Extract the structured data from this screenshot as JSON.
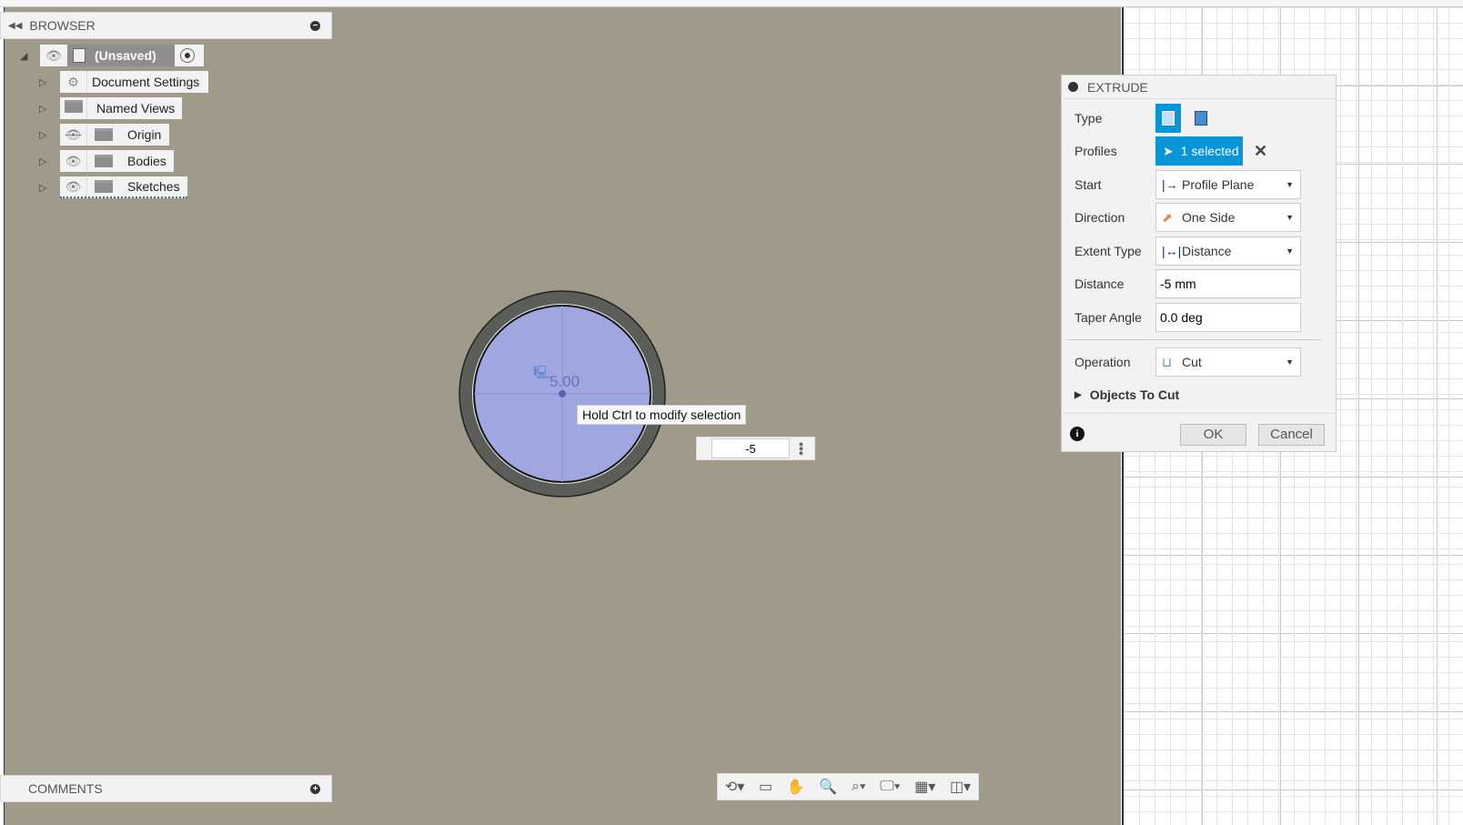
{
  "browser": {
    "title": "BROWSER",
    "root": "(Unsaved)",
    "items": [
      {
        "label": "Document Settings",
        "icon": "gear-icon"
      },
      {
        "label": "Named Views",
        "icon": "folder-icon"
      },
      {
        "label": "Origin",
        "icon": "folder-icon",
        "visibility": "hidden"
      },
      {
        "label": "Bodies",
        "icon": "folder-icon",
        "visibility": "visible"
      },
      {
        "label": "Sketches",
        "icon": "folder-icon",
        "visibility": "visible"
      }
    ]
  },
  "comments": {
    "title": "COMMENTS"
  },
  "viewport": {
    "dimension_label": "5.00",
    "tooltip": "Hold Ctrl to modify selection",
    "distance_input": "-5"
  },
  "extrude": {
    "title": "EXTRUDE",
    "type_label": "Type",
    "profiles_label": "Profiles",
    "profiles_value": "1 selected",
    "start_label": "Start",
    "start_value": "Profile Plane",
    "direction_label": "Direction",
    "direction_value": "One Side",
    "extent_label": "Extent Type",
    "extent_value": "Distance",
    "distance_label": "Distance",
    "distance_value": "-5 mm",
    "taper_label": "Taper Angle",
    "taper_value": "0.0 deg",
    "operation_label": "Operation",
    "operation_value": "Cut",
    "objects_label": "Objects To Cut",
    "ok": "OK",
    "cancel": "Cancel"
  },
  "colors": {
    "accent": "#0696d7",
    "viewport": "#a09a8a",
    "profile": "#a0a6e0"
  }
}
